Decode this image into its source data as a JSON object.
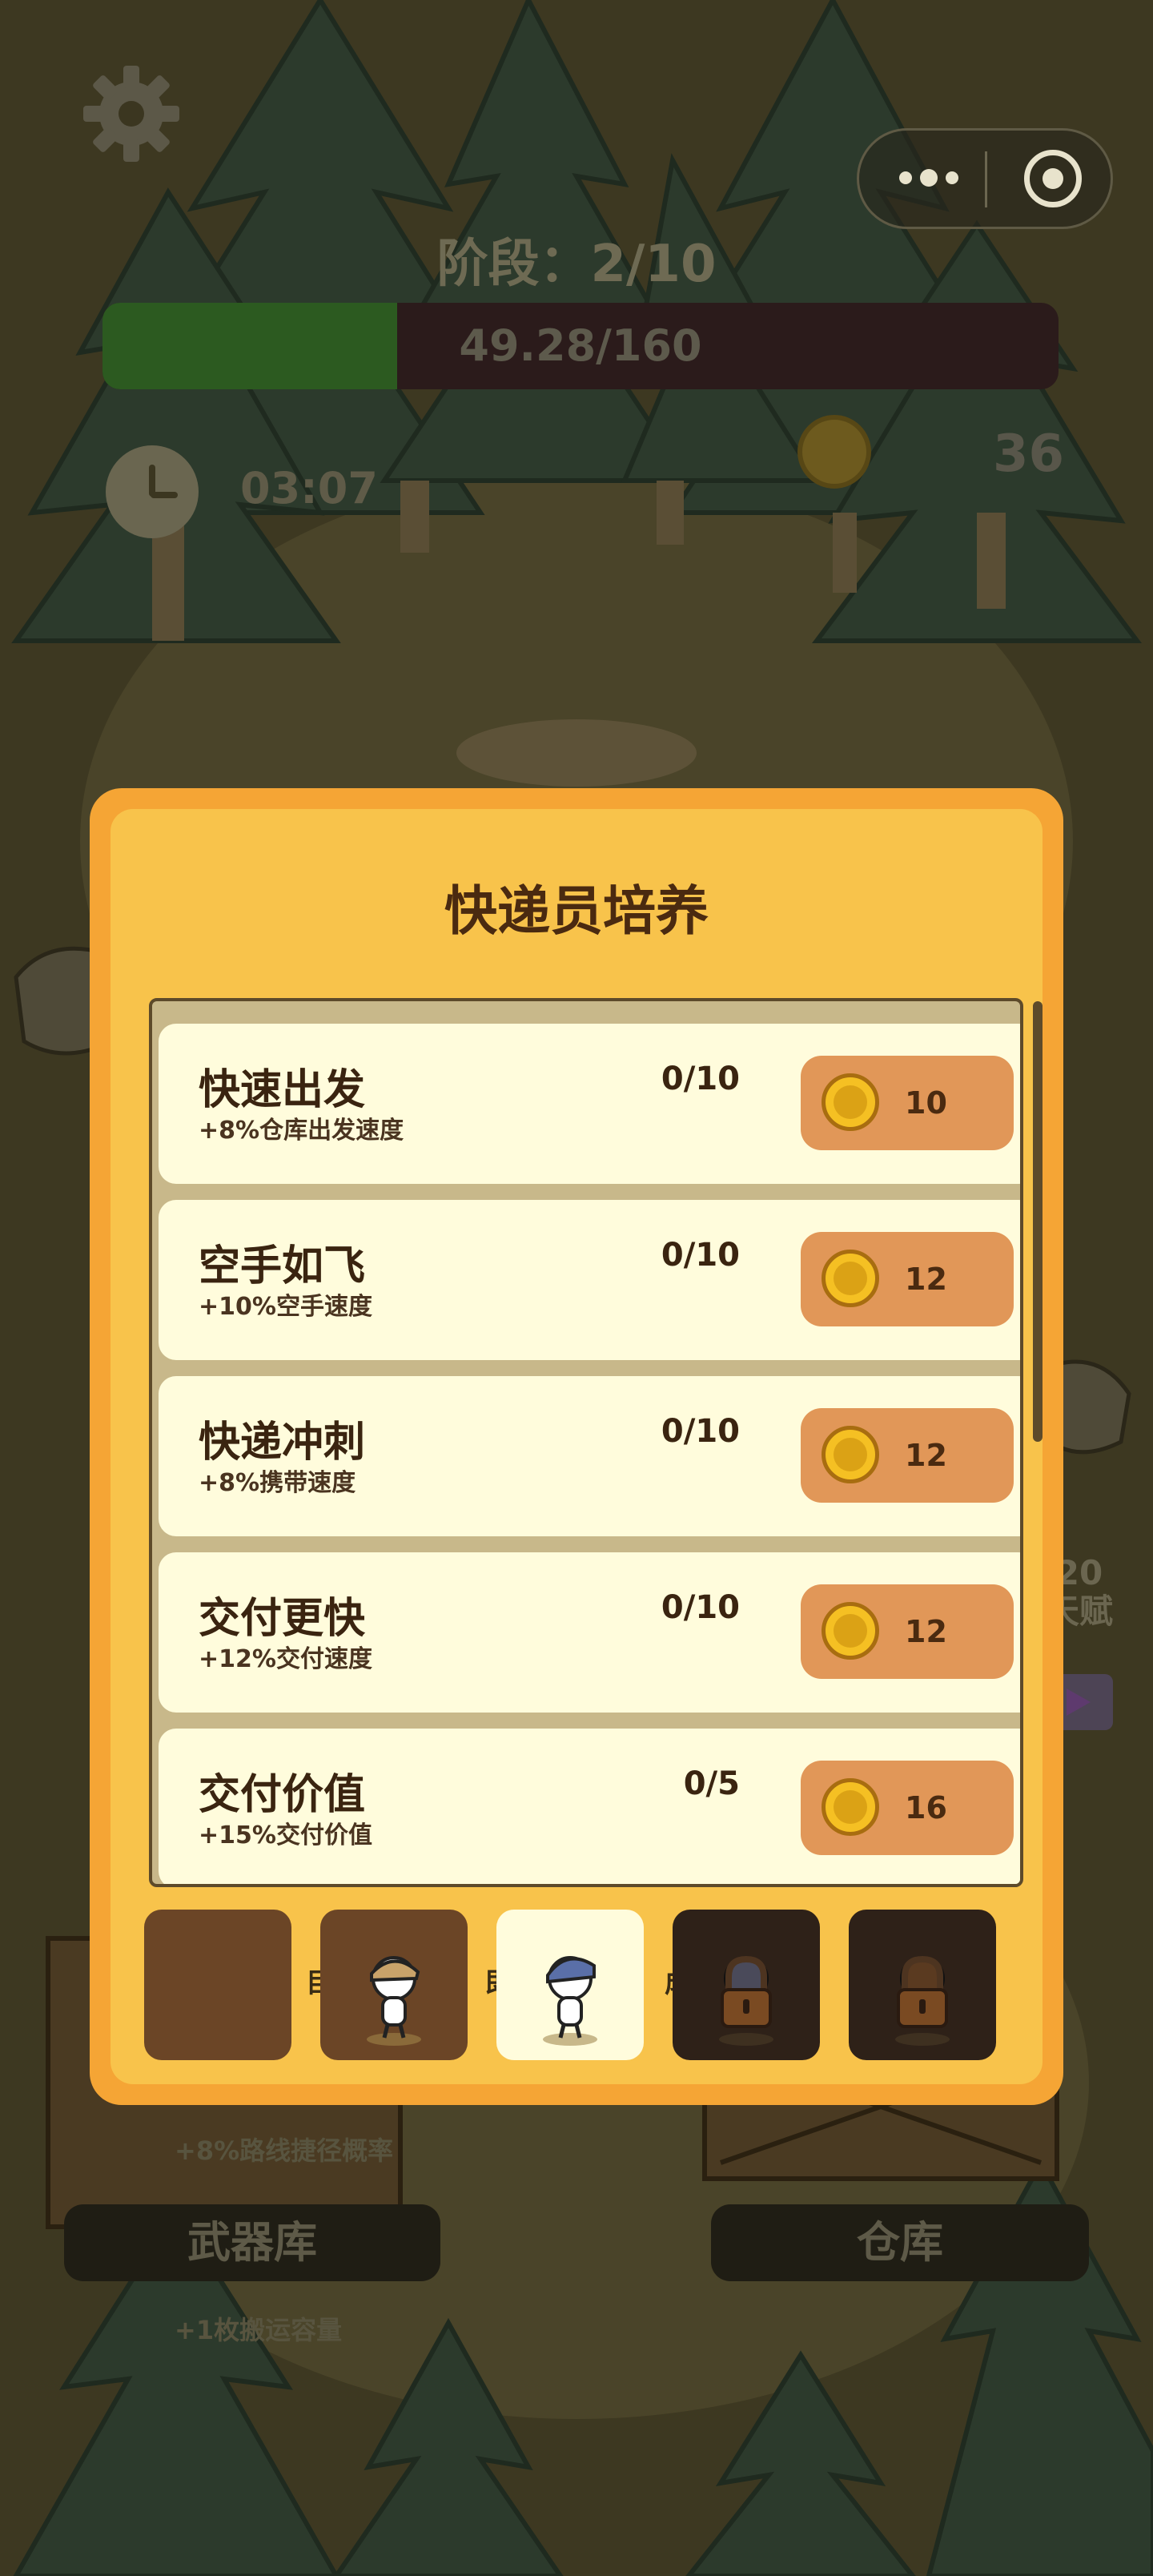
{
  "hud": {
    "stage": "阶段：2/10",
    "progress_text": "49.28/160",
    "progress_fraction": 0.308,
    "timer": "03:07",
    "coin_count": "36",
    "talent_line1": "20",
    "talent_line2": "天赋"
  },
  "background": {
    "weapon_label": "武器库",
    "warehouse_label": "仓库",
    "route_note": "+8%路线捷径概率",
    "capacity_note": "+1枚搬运容量",
    "hidden_text_a": "目标",
    "hidden_text_b": "即回",
    "hidden_text_c": "成"
  },
  "dialog": {
    "title": "快递员培养",
    "upgrades": [
      {
        "name": "快速出发",
        "desc": "+8%仓库出发速度",
        "progress": "0/10",
        "price": "10"
      },
      {
        "name": "空手如飞",
        "desc": "+10%空手速度",
        "progress": "0/10",
        "price": "12"
      },
      {
        "name": "快递冲刺",
        "desc": "+8%携带速度",
        "progress": "0/10",
        "price": "12"
      },
      {
        "name": "交付更快",
        "desc": "+12%交付速度",
        "progress": "0/10",
        "price": "12"
      },
      {
        "name": "交付价值",
        "desc": "+15%交付价值",
        "progress": "0/5",
        "price": "16"
      }
    ],
    "tabs": [
      {
        "state": "empty"
      },
      {
        "state": "character-tan"
      },
      {
        "state": "character-blue-selected"
      },
      {
        "state": "locked"
      },
      {
        "state": "locked"
      }
    ]
  },
  "colors": {
    "dialog_outer": "#f5a535",
    "dialog_inner": "#f8c34b",
    "row_bg": "#fffcdc",
    "buy_button": "#e19758",
    "coin": "#f5c023",
    "progress_fill": "#2c5a20"
  },
  "icons": [
    "gear-icon",
    "more-dots-icon",
    "target-icon",
    "clock-icon",
    "coin-icon",
    "lock-icon"
  ]
}
